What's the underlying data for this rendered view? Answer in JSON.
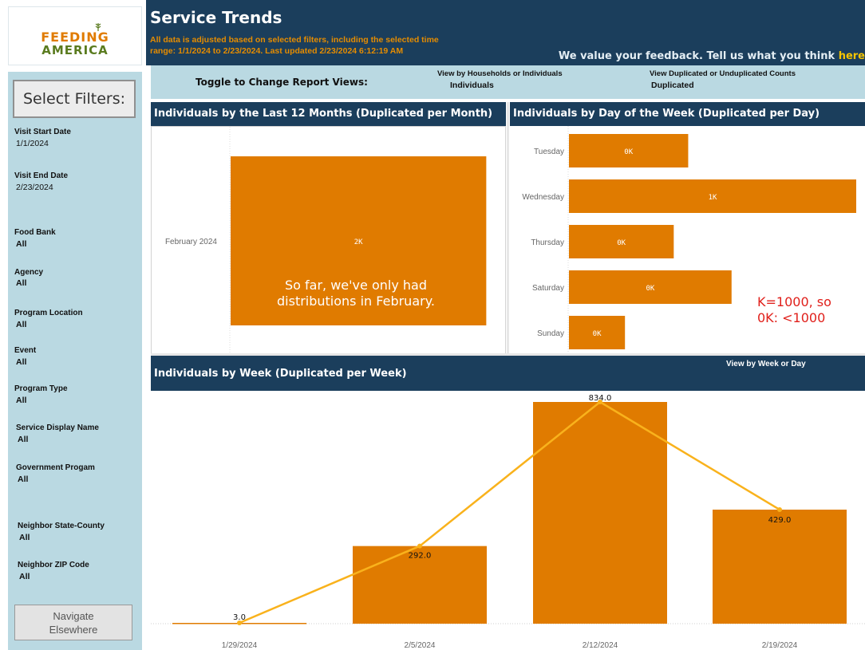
{
  "logo": {
    "line1": "FEEDING",
    "line2": "AMERICA"
  },
  "header": {
    "title": "Service Trends",
    "subtitle": "All data is adjusted based on selected filters, including the selected time range:  1/1/2024 to 2/23/2024. Last updated 2/23/2024 6:12:19 AM",
    "feedback_text": "We value your feedback. Tell us what you think ",
    "feedback_link": "here"
  },
  "sidebar": {
    "select_filters": "Select Filters:",
    "filters": [
      {
        "label": "Visit Start Date",
        "value": "1/1/2024"
      },
      {
        "label": "Visit End Date",
        "value": "2/23/2024"
      },
      {
        "label": "Food Bank",
        "value": "All"
      },
      {
        "label": "Agency",
        "value": "All"
      },
      {
        "label": "Program Location",
        "value": "All"
      },
      {
        "label": "Event",
        "value": "All"
      },
      {
        "label": "Program Type",
        "value": "All"
      },
      {
        "label": "Service Display Name",
        "value": "All"
      },
      {
        "label": "Government Progam",
        "value": "All"
      },
      {
        "label": "Neighbor State-County",
        "value": "All"
      },
      {
        "label": "Neighbor ZIP Code",
        "value": "All"
      }
    ],
    "navigate_line1": "Navigate",
    "navigate_line2": "Elsewhere"
  },
  "toggles": {
    "title": "Toggle to Change Report Views:",
    "households_label": "View by Households or Individuals",
    "households_value": "Individuals",
    "dup_label": "View Duplicated or Unduplicated Counts",
    "dup_value": "Duplicated",
    "week_label": "View by Week or Day",
    "week_value": ""
  },
  "panels": {
    "month_title": "Individuals by the Last 12 Months (Duplicated per Month)",
    "day_title": "Individuals by Day of the Week (Duplicated per Day)",
    "week_title": "Individuals by Week (Duplicated per Week)"
  },
  "annotations": {
    "feb_line1": "So far, we've only had",
    "feb_line2": "distributions in February.",
    "k_line1": "K=1000, so",
    "k_line2": "0K: <1000"
  },
  "colors": {
    "bar": "#e07b00",
    "line": "#f9b21c",
    "header": "#1b3e5c",
    "panel_bg": "#bad9e2",
    "annotation": "#e0201b"
  },
  "chart_data": [
    {
      "type": "bar",
      "orientation": "horizontal",
      "title": "Individuals by the Last 12 Months (Duplicated per Month)",
      "categories": [
        "February 2024"
      ],
      "values": [
        1558
      ],
      "labels": [
        "2K"
      ]
    },
    {
      "type": "bar",
      "orientation": "horizontal",
      "title": "Individuals by Day of the Week (Duplicated per Day)",
      "categories": [
        "Tuesday",
        "Wednesday",
        "Thursday",
        "Saturday",
        "Sunday"
      ],
      "values": [
        330,
        795,
        290,
        450,
        155
      ],
      "labels": [
        "0K",
        "1K",
        "0K",
        "0K",
        "0K"
      ]
    },
    {
      "type": "bar",
      "title": "Individuals by Week (Duplicated per Week)",
      "categories": [
        "1/29/2024",
        "2/5/2024",
        "2/12/2024",
        "2/19/2024"
      ],
      "values": [
        3.0,
        292.0,
        834.0,
        429.0
      ],
      "labels": [
        "3.0",
        "292.0",
        "834.0",
        "429.0"
      ],
      "overlay": "line"
    }
  ]
}
